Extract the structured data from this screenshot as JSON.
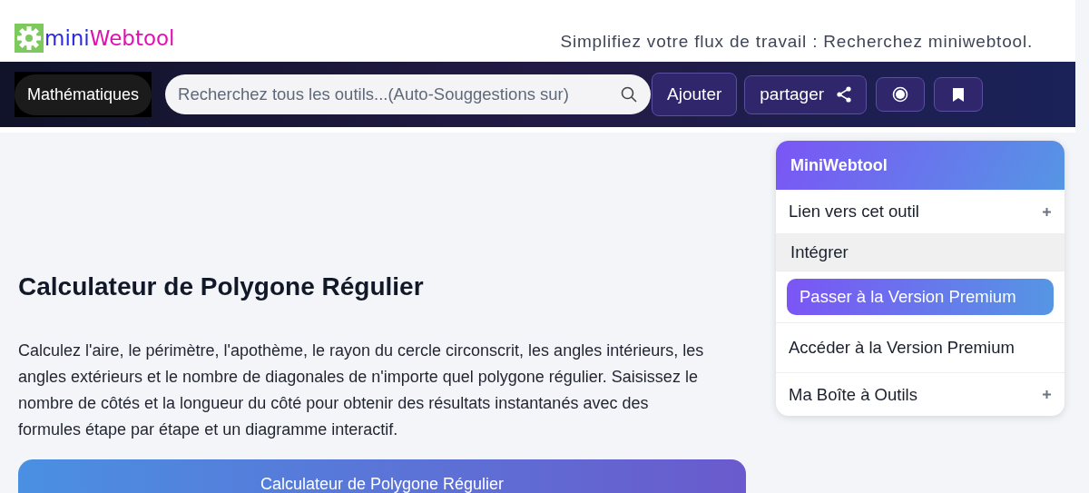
{
  "header": {
    "logo": {
      "part_1": "mini",
      "part_2": "Webtool"
    },
    "tagline": "Simplifiez votre flux de travail : Recherchez miniwebtool."
  },
  "navbar": {
    "category": "Mathématiques",
    "search": {
      "placeholder": "Recherchez tous les outils...(Auto-Souggestions sur)"
    },
    "add_button": "Ajouter",
    "share_button": "partager"
  },
  "main": {
    "title": "Calculateur de Polygone Régulier",
    "description": "Calculez l'aire, le périmètre, l'apothème, le rayon du cercle circonscrit, les angles intérieurs, les angles extérieurs et le nombre de diagonales de n'importe quel polygone régulier. Saisissez le nombre de côtés et la longueur du côté pour obtenir des résultats instantanés avec des formules étape par étape et un diagramme interactif.",
    "card_title": "Calculateur de Polygone Régulier"
  },
  "sidebar": {
    "title": "MiniWebtool",
    "items": [
      {
        "label": "Lien vers cet outil",
        "kind": "expandable"
      },
      {
        "label": "Intégrer",
        "kind": "highlight"
      },
      {
        "label": "Passer à la Version Premium",
        "kind": "premium"
      },
      {
        "label": "Accéder à la Version Premium",
        "kind": "plain"
      },
      {
        "label": "Ma Boîte à Outils",
        "kind": "expandable"
      }
    ]
  }
}
